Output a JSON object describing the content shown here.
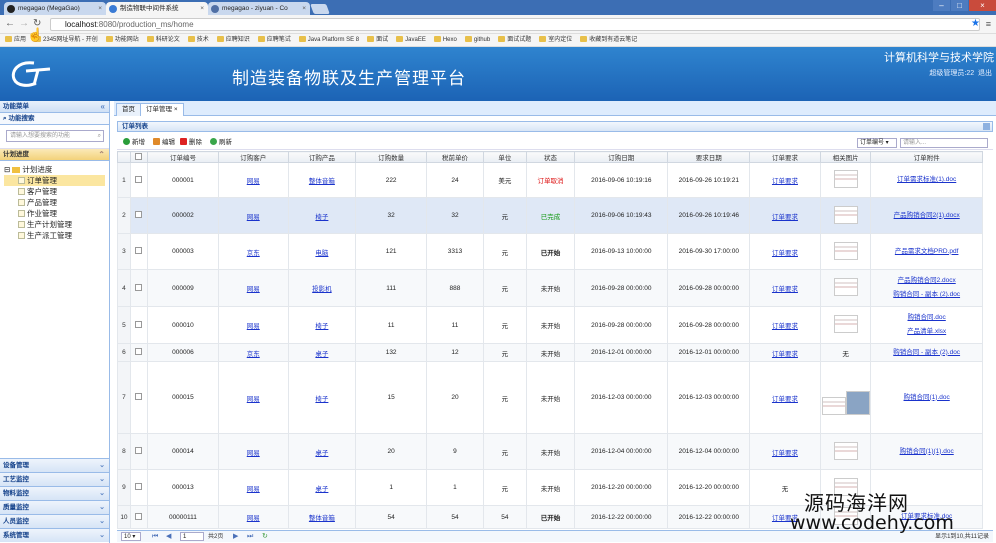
{
  "browser": {
    "tabs": [
      {
        "label": "megagao (MegaGao)"
      },
      {
        "label": "制造物联中间件系统"
      },
      {
        "label": "megagao - ziyuan - Co"
      }
    ],
    "url_host": "localhost",
    "url_path": ":8080/production_ms/home",
    "bookmarks": [
      "应用",
      "2345网址导航 - 开创",
      "功能网站",
      "科研论文",
      "技术",
      "应聘知识",
      "应聘笔试",
      "Java Platform SE 8",
      "面试",
      "JavaEE",
      "Hexo",
      "github",
      "面试试题",
      "室内定位",
      "收藏到有道云笔记"
    ]
  },
  "header": {
    "title": "制造装备物联及生产管理平台",
    "school": "计算机科学与技术学院",
    "user_text": "超级管理员:22",
    "logout": "退出"
  },
  "left": {
    "menu_title": "功能菜单",
    "search_title": "功能搜索",
    "search_placeholder": "请输入想要搜索的功能",
    "section_title": "计划进度",
    "root": "计划进度",
    "items": [
      "订单管理",
      "客户管理",
      "产品管理",
      "作业管理",
      "生产计划管理",
      "生产派工管理"
    ],
    "accordion": [
      "设备管理",
      "工艺监控",
      "物料监控",
      "质量监控",
      "人员监控",
      "系统管理"
    ]
  },
  "main": {
    "tabs": [
      {
        "label": "首页"
      },
      {
        "label": "订单管理"
      }
    ],
    "panel_title": "订单列表",
    "toolbar": {
      "add": "新增",
      "edit": "编辑",
      "delete": "删除",
      "refresh": "刷新",
      "filter_select": "订单编号",
      "filter_placeholder": "请输入..."
    },
    "columns": [
      "",
      "订单编号",
      "订购客户",
      "订购产品",
      "订购数量",
      "税前单价",
      "单位",
      "状态",
      "订购日期",
      "要求日期",
      "订单要求",
      "相关图片",
      "订单附件"
    ],
    "rows": [
      {
        "n": "1",
        "id": "000001",
        "customer": "网易",
        "product": "整体音箱",
        "qty": "222",
        "price": "24",
        "unit": "美元",
        "status": "订单取消",
        "status_style": "red",
        "odate": "2016-09-06 10:19:16",
        "rdate": "2016-09-26 10:19:21",
        "req": "订单要求",
        "img": "1",
        "files": [
          "订单需求标准(1).doc"
        ]
      },
      {
        "n": "2",
        "id": "000002",
        "customer": "网易",
        "product": "椅子",
        "qty": "32",
        "price": "32",
        "unit": "元",
        "status": "已完成",
        "status_style": "green",
        "odate": "2016-09-06 10:19:43",
        "rdate": "2016-09-26 10:19:46",
        "req": "订单要求",
        "img": "1",
        "files": [
          "产品购销合同2(1).docx"
        ]
      },
      {
        "n": "3",
        "id": "000003",
        "customer": "京东",
        "product": "电脑",
        "qty": "121",
        "price": "3313",
        "unit": "元",
        "status": "已开始",
        "status_style": "bold",
        "odate": "2016-09-13 10:00:00",
        "rdate": "2016-09-30 17:00:00",
        "req": "订单要求",
        "img": "1",
        "files": [
          "产品需求文档PRD.pdf"
        ]
      },
      {
        "n": "4",
        "id": "000009",
        "customer": "网易",
        "product": "投影机",
        "qty": "111",
        "price": "888",
        "unit": "元",
        "status": "未开始",
        "status_style": "",
        "odate": "2016-09-28 00:00:00",
        "rdate": "2016-09-28 00:00:00",
        "req": "订单要求",
        "img": "1",
        "files": [
          "产品购销合同2.docx",
          "购销合同 - 副本 (2).doc"
        ]
      },
      {
        "n": "5",
        "id": "000010",
        "customer": "网易",
        "product": "椅子",
        "qty": "11",
        "price": "11",
        "unit": "元",
        "status": "未开始",
        "status_style": "",
        "odate": "2016-09-28 00:00:00",
        "rdate": "2016-09-28 00:00:00",
        "req": "订单要求",
        "img": "1",
        "files": [
          "购销合同.doc",
          "产品清单.xlsx"
        ]
      },
      {
        "n": "6",
        "id": "000006",
        "customer": "京东",
        "product": "桌子",
        "qty": "132",
        "price": "12",
        "unit": "元",
        "status": "未开始",
        "status_style": "",
        "odate": "2016-12-01 00:00:00",
        "rdate": "2016-12-01 00:00:00",
        "req": "订单要求",
        "img": "无",
        "files": [
          "购销合同 - 副本 (2).doc"
        ]
      },
      {
        "n": "7",
        "id": "000015",
        "customer": "网易",
        "product": "椅子",
        "qty": "15",
        "price": "20",
        "unit": "元",
        "status": "未开始",
        "status_style": "",
        "odate": "2016-12-03 00:00:00",
        "rdate": "2016-12-03 00:00:00",
        "req": "订单要求",
        "img": "2",
        "files": [
          "购销合同(1).doc"
        ]
      },
      {
        "n": "8",
        "id": "000014",
        "customer": "网易",
        "product": "桌子",
        "qty": "20",
        "price": "9",
        "unit": "元",
        "status": "未开始",
        "status_style": "",
        "odate": "2016-12-04 00:00:00",
        "rdate": "2016-12-04 00:00:00",
        "req": "订单要求",
        "img": "1",
        "files": [
          "购销合同(1)(1).doc"
        ]
      },
      {
        "n": "9",
        "id": "000013",
        "customer": "网易",
        "product": "桌子",
        "qty": "1",
        "price": "1",
        "unit": "元",
        "status": "未开始",
        "status_style": "",
        "odate": "2016-12-20 00:00:00",
        "rdate": "2016-12-20 00:00:00",
        "req": "无",
        "img": "1",
        "files": []
      },
      {
        "n": "10",
        "id": "00000111",
        "customer": "网易",
        "product": "整体音箱",
        "qty": "54",
        "price": "54",
        "unit": "54",
        "status": "已开始",
        "status_style": "bold",
        "odate": "2016-12-22 00:00:00",
        "rdate": "2016-12-22 00:00:00",
        "req": "订单要求",
        "img": "1",
        "files": [
          "订单要求标准.doc"
        ]
      }
    ],
    "pager": {
      "page_size": "10",
      "page": "1",
      "total_pages": "共2页",
      "info": "显示1到10,共11记录"
    }
  },
  "watermark": {
    "line1": "源码海洋网",
    "line2": "www.codehy.com"
  }
}
